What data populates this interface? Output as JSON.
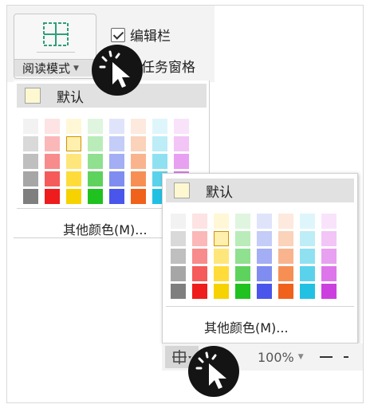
{
  "ribbon": {
    "reading_mode_label": "阅读模式",
    "edit_bar_label": "编辑栏",
    "task_pane_label": "任务窗格"
  },
  "palette_top": {
    "default_label": "默认",
    "more_label": "其他颜色(M)..."
  },
  "palette_bottom": {
    "default_label": "默认",
    "more_label": "其他颜色(M)..."
  },
  "status_bar": {
    "zoom_label": "100%"
  },
  "colors": {
    "default_swatch": "#fdf8d0",
    "columns": [
      [
        "#f2f2f2",
        "#d9d9d9",
        "#bfbfbf",
        "#a6a6a6",
        "#7f7f7f"
      ],
      [
        "#fde3e3",
        "#fbb8b8",
        "#f88b8b",
        "#f55b5b",
        "#ee1c1c"
      ],
      [
        "#fff7d6",
        "#fff0ad",
        "#ffe67a",
        "#ffdc3a",
        "#f6d200"
      ],
      [
        "#dff5df",
        "#b9ecb9",
        "#8fe08f",
        "#5dd35d",
        "#1fc21f"
      ],
      [
        "#e0e4fb",
        "#c4ccf8",
        "#a3aef5",
        "#7f8df1",
        "#4a55ec"
      ],
      [
        "#fde9dd",
        "#fbd2ba",
        "#f9b48e",
        "#f78f55",
        "#f0611b"
      ],
      [
        "#def6fb",
        "#bdedf7",
        "#8fe1f2",
        "#5bd2ec",
        "#22c1e3"
      ],
      [
        "#f9e3fb",
        "#f2c5f6",
        "#e8a0f1",
        "#de76eb",
        "#cc3fdf"
      ]
    ]
  }
}
